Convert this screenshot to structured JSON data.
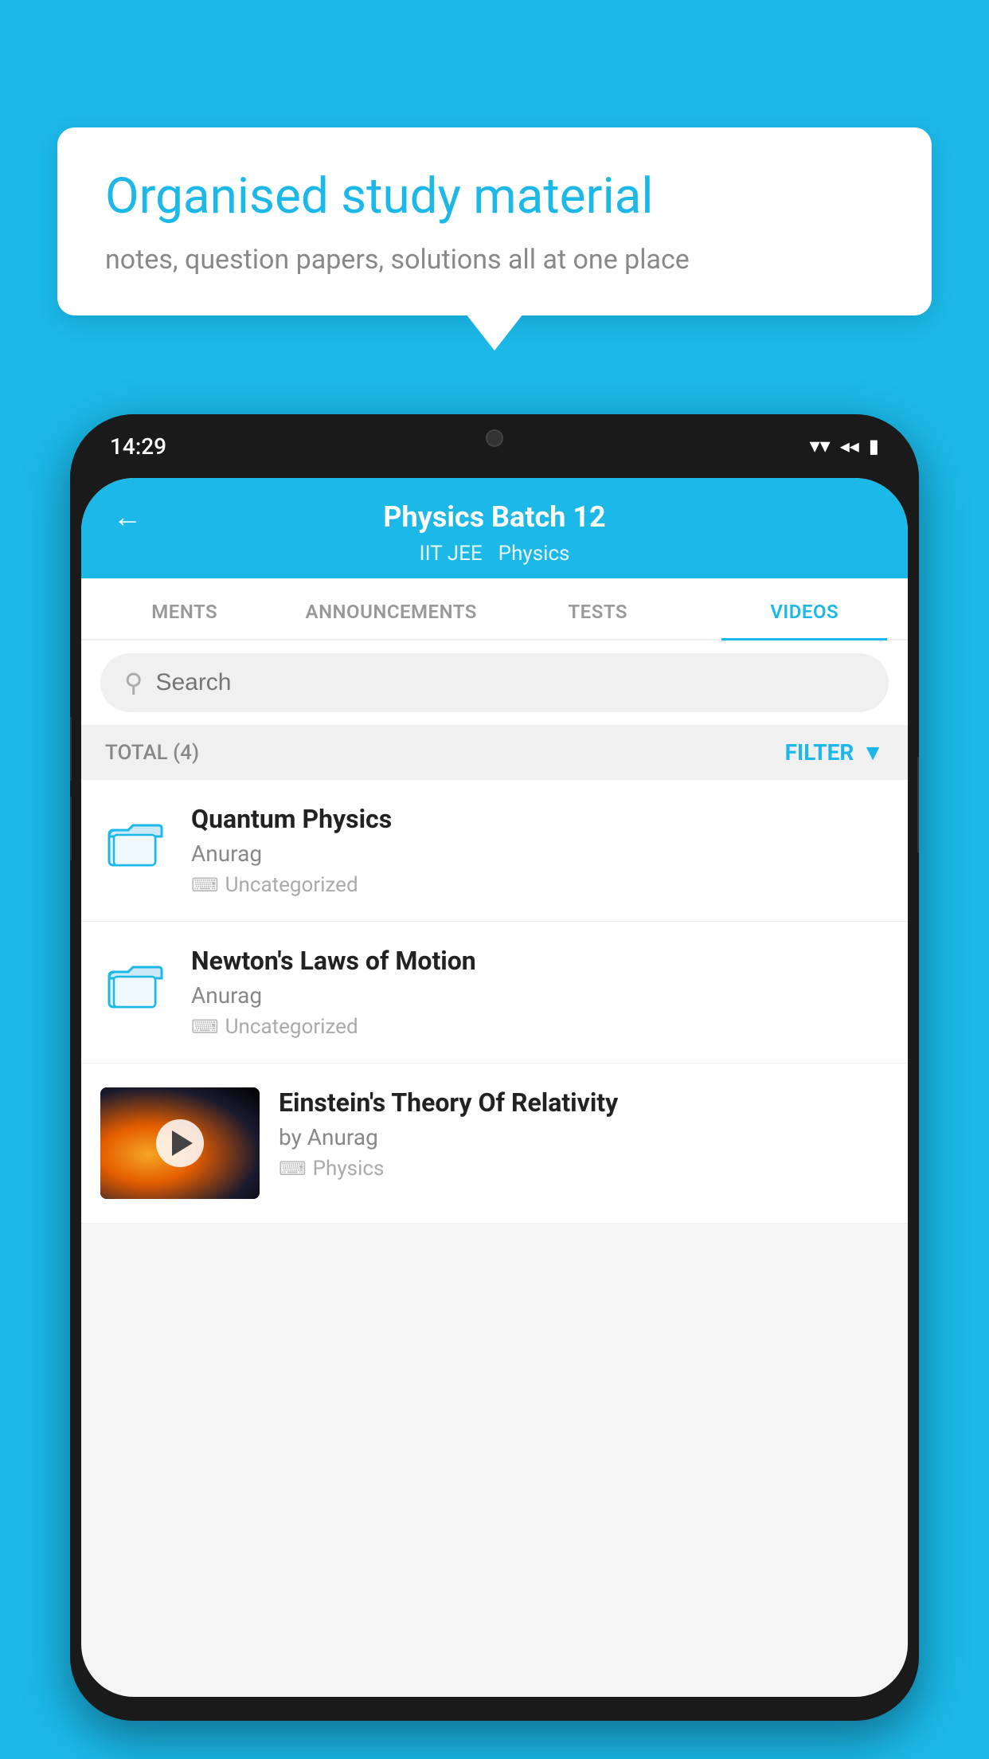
{
  "background_color": "#1bb8e8",
  "speech_bubble": {
    "title": "Organised study material",
    "subtitle": "notes, question papers, solutions all at one place"
  },
  "phone": {
    "time": "14:29",
    "app_header": {
      "title": "Physics Batch 12",
      "subtitle_part1": "IIT JEE",
      "subtitle_part2": "Physics"
    },
    "tabs": [
      {
        "label": "MENTS",
        "active": false
      },
      {
        "label": "ANNOUNCEMENTS",
        "active": false
      },
      {
        "label": "TESTS",
        "active": false
      },
      {
        "label": "VIDEOS",
        "active": true
      }
    ],
    "search": {
      "placeholder": "Search"
    },
    "filter": {
      "total_label": "TOTAL (4)",
      "button_label": "FILTER"
    },
    "videos": [
      {
        "id": 1,
        "title": "Quantum Physics",
        "author": "Anurag",
        "tag": "Uncategorized",
        "has_thumbnail": false
      },
      {
        "id": 2,
        "title": "Newton's Laws of Motion",
        "author": "Anurag",
        "tag": "Uncategorized",
        "has_thumbnail": false
      },
      {
        "id": 3,
        "title": "Einstein's Theory Of Relativity",
        "author": "by Anurag",
        "tag": "Physics",
        "has_thumbnail": true
      }
    ]
  }
}
